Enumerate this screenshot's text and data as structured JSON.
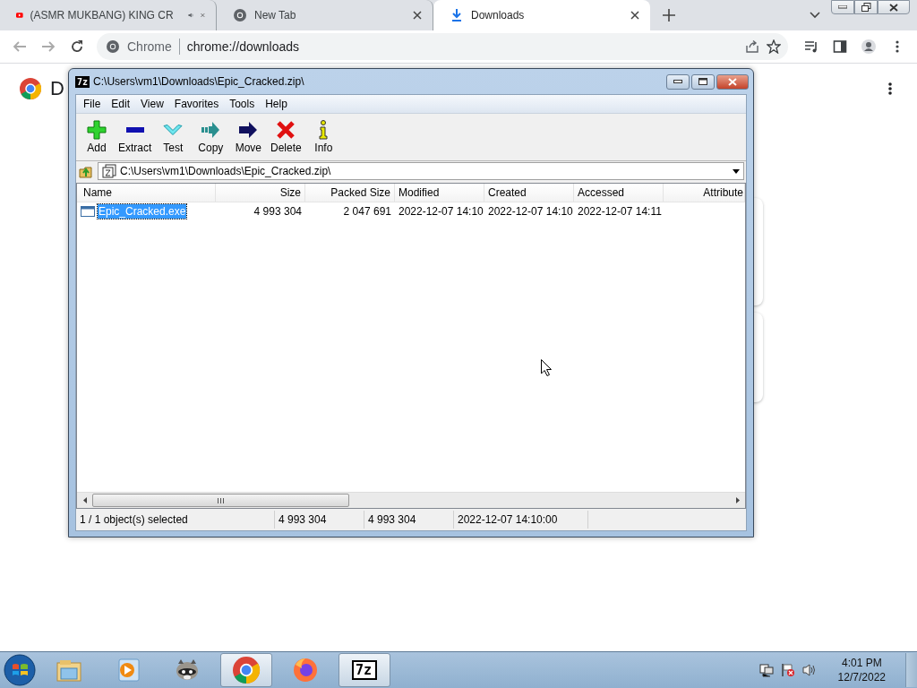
{
  "browser": {
    "tabs": [
      {
        "title": "(ASMR MUKBANG) KING CR",
        "kind": "video",
        "audio": true,
        "selected": false
      },
      {
        "title": "New Tab",
        "kind": "newtab",
        "audio": false,
        "selected": false
      },
      {
        "title": "Downloads",
        "kind": "downloads",
        "audio": false,
        "selected": true
      }
    ],
    "omnibox": {
      "site": "Chrome",
      "url": "chrome://downloads"
    }
  },
  "page": {
    "title": "D"
  },
  "archiver": {
    "app_icon": "7z",
    "title": "C:\\Users\\vm1\\Downloads\\Epic_Cracked.zip\\",
    "menu": [
      "File",
      "Edit",
      "View",
      "Favorites",
      "Tools",
      "Help"
    ],
    "toolbar": [
      {
        "label": "Add",
        "kind": "add"
      },
      {
        "label": "Extract",
        "kind": "extract"
      },
      {
        "label": "Test",
        "kind": "test"
      },
      {
        "label": "Copy",
        "kind": "copy"
      },
      {
        "label": "Move",
        "kind": "move"
      },
      {
        "label": "Delete",
        "kind": "delete"
      },
      {
        "label": "Info",
        "kind": "info"
      }
    ],
    "path": "C:\\Users\\vm1\\Downloads\\Epic_Cracked.zip\\",
    "table": {
      "columns": [
        "Name",
        "Size",
        "Packed Size",
        "Modified",
        "Created",
        "Accessed",
        "Attribute"
      ],
      "rows": [
        {
          "selected": true,
          "cells": [
            "Epic_Cracked.exe",
            "4 993 304",
            "2 047 691",
            "2022-12-07 14:10",
            "2022-12-07 14:10",
            "2022-12-07 14:11"
          ]
        }
      ]
    },
    "status_bar": [
      "1 / 1 object(s) selected",
      "4 993 304",
      "4 993 304",
      "2022-12-07 14:10:00"
    ]
  },
  "taskbar": {
    "apps": [
      {
        "kind": "explorer",
        "active": false
      },
      {
        "kind": "media",
        "active": false
      },
      {
        "kind": "raccoon",
        "active": false
      },
      {
        "kind": "chrome",
        "active": true
      },
      {
        "kind": "firefox",
        "active": false
      },
      {
        "kind": "sevenzip",
        "label": "7z",
        "active": true
      }
    ],
    "clock": {
      "time": "4:01 PM",
      "date": "12/7/2022"
    }
  }
}
